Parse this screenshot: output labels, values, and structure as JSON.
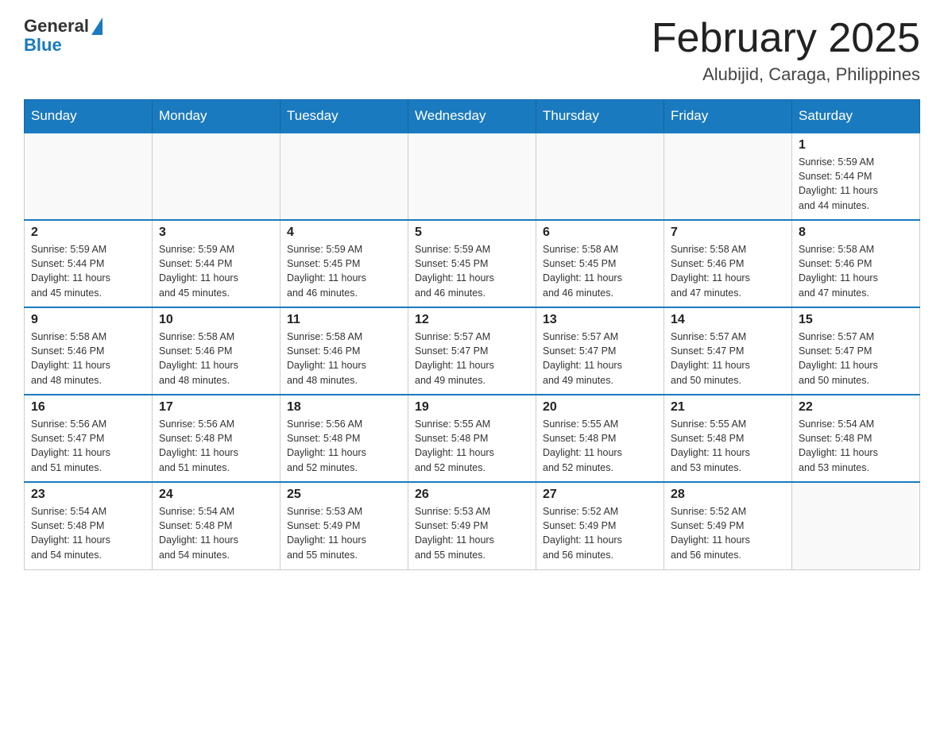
{
  "header": {
    "logo_general": "General",
    "logo_blue": "Blue",
    "month_title": "February 2025",
    "location": "Alubijid, Caraga, Philippines"
  },
  "days_of_week": [
    "Sunday",
    "Monday",
    "Tuesday",
    "Wednesday",
    "Thursday",
    "Friday",
    "Saturday"
  ],
  "weeks": [
    {
      "days": [
        {
          "number": "",
          "info": ""
        },
        {
          "number": "",
          "info": ""
        },
        {
          "number": "",
          "info": ""
        },
        {
          "number": "",
          "info": ""
        },
        {
          "number": "",
          "info": ""
        },
        {
          "number": "",
          "info": ""
        },
        {
          "number": "1",
          "info": "Sunrise: 5:59 AM\nSunset: 5:44 PM\nDaylight: 11 hours\nand 44 minutes."
        }
      ]
    },
    {
      "days": [
        {
          "number": "2",
          "info": "Sunrise: 5:59 AM\nSunset: 5:44 PM\nDaylight: 11 hours\nand 45 minutes."
        },
        {
          "number": "3",
          "info": "Sunrise: 5:59 AM\nSunset: 5:44 PM\nDaylight: 11 hours\nand 45 minutes."
        },
        {
          "number": "4",
          "info": "Sunrise: 5:59 AM\nSunset: 5:45 PM\nDaylight: 11 hours\nand 46 minutes."
        },
        {
          "number": "5",
          "info": "Sunrise: 5:59 AM\nSunset: 5:45 PM\nDaylight: 11 hours\nand 46 minutes."
        },
        {
          "number": "6",
          "info": "Sunrise: 5:58 AM\nSunset: 5:45 PM\nDaylight: 11 hours\nand 46 minutes."
        },
        {
          "number": "7",
          "info": "Sunrise: 5:58 AM\nSunset: 5:46 PM\nDaylight: 11 hours\nand 47 minutes."
        },
        {
          "number": "8",
          "info": "Sunrise: 5:58 AM\nSunset: 5:46 PM\nDaylight: 11 hours\nand 47 minutes."
        }
      ]
    },
    {
      "days": [
        {
          "number": "9",
          "info": "Sunrise: 5:58 AM\nSunset: 5:46 PM\nDaylight: 11 hours\nand 48 minutes."
        },
        {
          "number": "10",
          "info": "Sunrise: 5:58 AM\nSunset: 5:46 PM\nDaylight: 11 hours\nand 48 minutes."
        },
        {
          "number": "11",
          "info": "Sunrise: 5:58 AM\nSunset: 5:46 PM\nDaylight: 11 hours\nand 48 minutes."
        },
        {
          "number": "12",
          "info": "Sunrise: 5:57 AM\nSunset: 5:47 PM\nDaylight: 11 hours\nand 49 minutes."
        },
        {
          "number": "13",
          "info": "Sunrise: 5:57 AM\nSunset: 5:47 PM\nDaylight: 11 hours\nand 49 minutes."
        },
        {
          "number": "14",
          "info": "Sunrise: 5:57 AM\nSunset: 5:47 PM\nDaylight: 11 hours\nand 50 minutes."
        },
        {
          "number": "15",
          "info": "Sunrise: 5:57 AM\nSunset: 5:47 PM\nDaylight: 11 hours\nand 50 minutes."
        }
      ]
    },
    {
      "days": [
        {
          "number": "16",
          "info": "Sunrise: 5:56 AM\nSunset: 5:47 PM\nDaylight: 11 hours\nand 51 minutes."
        },
        {
          "number": "17",
          "info": "Sunrise: 5:56 AM\nSunset: 5:48 PM\nDaylight: 11 hours\nand 51 minutes."
        },
        {
          "number": "18",
          "info": "Sunrise: 5:56 AM\nSunset: 5:48 PM\nDaylight: 11 hours\nand 52 minutes."
        },
        {
          "number": "19",
          "info": "Sunrise: 5:55 AM\nSunset: 5:48 PM\nDaylight: 11 hours\nand 52 minutes."
        },
        {
          "number": "20",
          "info": "Sunrise: 5:55 AM\nSunset: 5:48 PM\nDaylight: 11 hours\nand 52 minutes."
        },
        {
          "number": "21",
          "info": "Sunrise: 5:55 AM\nSunset: 5:48 PM\nDaylight: 11 hours\nand 53 minutes."
        },
        {
          "number": "22",
          "info": "Sunrise: 5:54 AM\nSunset: 5:48 PM\nDaylight: 11 hours\nand 53 minutes."
        }
      ]
    },
    {
      "days": [
        {
          "number": "23",
          "info": "Sunrise: 5:54 AM\nSunset: 5:48 PM\nDaylight: 11 hours\nand 54 minutes."
        },
        {
          "number": "24",
          "info": "Sunrise: 5:54 AM\nSunset: 5:48 PM\nDaylight: 11 hours\nand 54 minutes."
        },
        {
          "number": "25",
          "info": "Sunrise: 5:53 AM\nSunset: 5:49 PM\nDaylight: 11 hours\nand 55 minutes."
        },
        {
          "number": "26",
          "info": "Sunrise: 5:53 AM\nSunset: 5:49 PM\nDaylight: 11 hours\nand 55 minutes."
        },
        {
          "number": "27",
          "info": "Sunrise: 5:52 AM\nSunset: 5:49 PM\nDaylight: 11 hours\nand 56 minutes."
        },
        {
          "number": "28",
          "info": "Sunrise: 5:52 AM\nSunset: 5:49 PM\nDaylight: 11 hours\nand 56 minutes."
        },
        {
          "number": "",
          "info": ""
        }
      ]
    }
  ]
}
